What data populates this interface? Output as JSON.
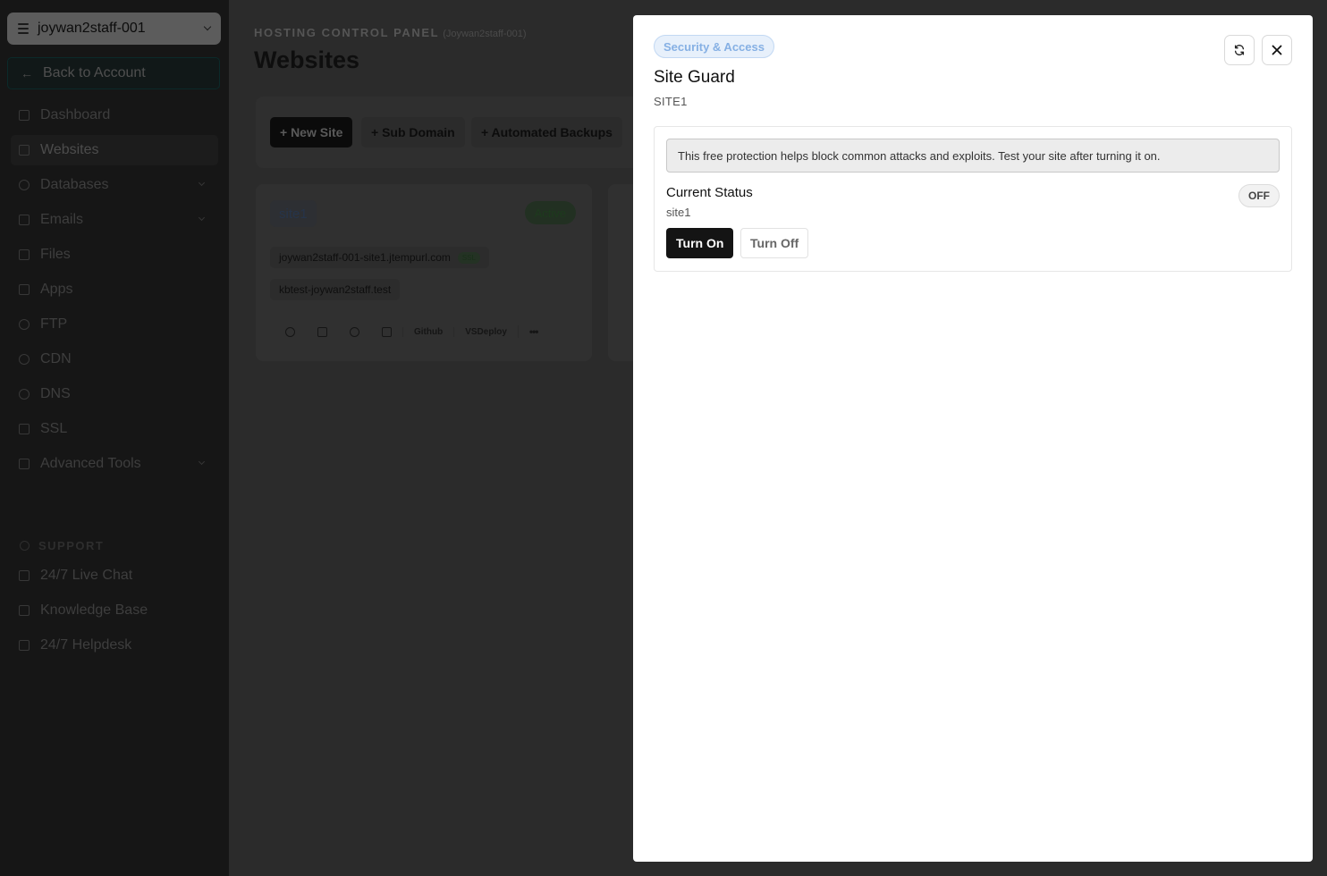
{
  "sidebar": {
    "account": "joywan2staff-001",
    "back_label": "Back to Account",
    "items": [
      {
        "label": "Dashboard"
      },
      {
        "label": "Websites"
      },
      {
        "label": "Databases"
      },
      {
        "label": "Emails"
      },
      {
        "label": "Files"
      },
      {
        "label": "Apps"
      },
      {
        "label": "FTP"
      },
      {
        "label": "CDN"
      },
      {
        "label": "DNS"
      },
      {
        "label": "SSL"
      },
      {
        "label": "Advanced Tools"
      }
    ],
    "support_label": "SUPPORT",
    "support_items": [
      {
        "label": "24/7 Live Chat"
      },
      {
        "label": "Knowledge Base"
      },
      {
        "label": "24/7 Helpdesk"
      }
    ]
  },
  "main": {
    "breadcrumb": "HOSTING CONTROL PANEL",
    "breadcrumb_sub": "(Joywan2staff-001)",
    "title": "Websites",
    "toolbar": {
      "new_site": "+ New Site",
      "sub_domain": "+ Sub Domain",
      "backups": "+ Automated Backups"
    },
    "site_card": {
      "name": "site1",
      "status": "Active",
      "domain1": "joywan2staff-001-site1.jtempurl.com",
      "ssl": "SSL",
      "domain2": "kbtest-joywan2staff.test",
      "github": "Github",
      "vsdeploy": "VSDeploy",
      "more": "•••"
    }
  },
  "modal": {
    "badge": "Security & Access",
    "title": "Site Guard",
    "subtitle": "SITE1",
    "notice": "This free protection helps block common attacks and exploits. Test your site after turning it on.",
    "status_label": "Current Status",
    "status_site": "site1",
    "status_value": "OFF",
    "turn_on": "Turn On",
    "turn_off": "Turn Off"
  }
}
